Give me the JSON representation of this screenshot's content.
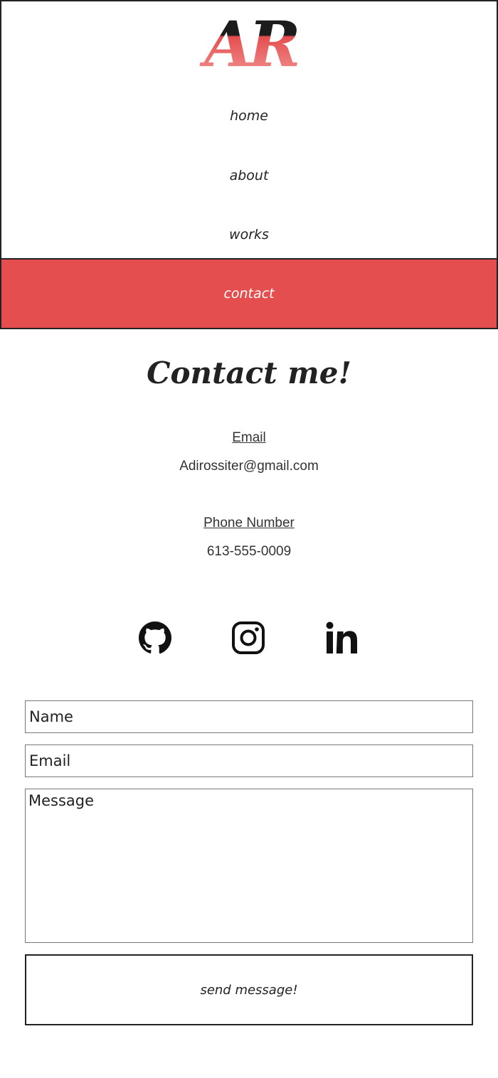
{
  "logo": {
    "text": "AR"
  },
  "nav": {
    "items": [
      {
        "label": "home"
      },
      {
        "label": "about"
      },
      {
        "label": "works"
      },
      {
        "label": "contact"
      }
    ],
    "active_color": "#e54e4e"
  },
  "main": {
    "title": "Contact me!",
    "email_label": "Email",
    "email_value": "Adirossiter@gmail.com",
    "phone_label": "Phone Number",
    "phone_value": "613-555-0009"
  },
  "social": {
    "icons": [
      "github-icon",
      "instagram-icon",
      "linkedin-icon"
    ]
  },
  "form": {
    "name_placeholder": "Name",
    "email_placeholder": "Email",
    "message_placeholder": "Message",
    "submit_label": "send message!"
  }
}
